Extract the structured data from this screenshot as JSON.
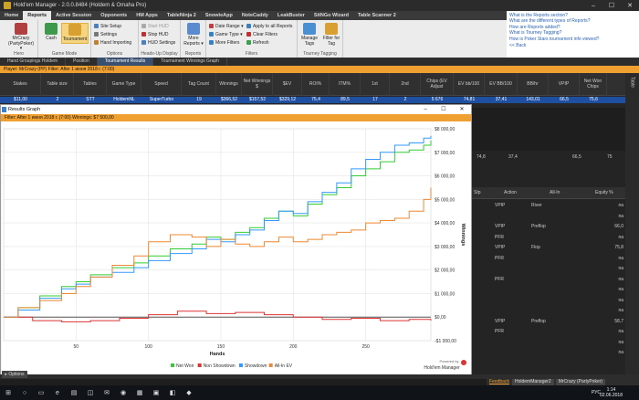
{
  "window": {
    "title": "Hold'em Manager - 2.0.0.8484 (Holdem & Omaha Pro)"
  },
  "menu": [
    "Home",
    "Reports",
    "Active Session",
    "Opponents",
    "HM Apps",
    "TableNinja 2",
    "SnowieApp",
    "NoteCaddy",
    "LeakBuster",
    "SitNGo Wizard",
    "Table Scanner 2"
  ],
  "menu_active": "Reports",
  "ribbon": {
    "hero": {
      "btn": "MrCrazy (PartyPoker) ▾",
      "cap": "Hero"
    },
    "game_mode": {
      "cash": "Cash",
      "tournament": "Tournament",
      "cap": "Game Mode"
    },
    "options": {
      "site_setup": "Site Setup",
      "settings": "Settings",
      "hand_importing": "Hand Importing",
      "cap": "Options"
    },
    "hud": {
      "start": "Start HUD",
      "stop": "Stop HUD",
      "settings": "HUD Settings",
      "cap": "Heads-Up Display"
    },
    "reports": {
      "more": "More Reports ▾",
      "cap": "Reports"
    },
    "filters": {
      "date_range": "Date Range ▾",
      "game_type": "Game Type ▾",
      "more_filters": "More Filters",
      "apply_all": "Apply to all Reports",
      "clear": "Clear Filters",
      "refresh": "Refresh",
      "cap": "Filters"
    },
    "tags": {
      "manage": "Manage Tags",
      "filter_tag": "Filter for Tag",
      "cap": "Tourney Tagging"
    }
  },
  "help": {
    "links": [
      "What is the Reports section?",
      "What are the different types of Reports?",
      "How are Reports added?",
      "What is Tourney Tagging?",
      "How is Poker Stars tournament info viewed?"
    ],
    "back": "<< Back"
  },
  "report_tabs": [
    "Hand Groupings Holdem",
    "Position",
    "Tournament Results",
    "Tournament Winnings Graph"
  ],
  "report_tab_active": "Tournament Results",
  "player_bar": "Player: MrCrazy (PP)  Filter: After 1 июня 2018 г. (7:00)",
  "results_grid": {
    "headers": [
      "Stakes",
      "Table size",
      "Tables",
      "Game Type",
      "Speed",
      "Tag Count",
      "Winnings",
      "Net Winnings $",
      "$EV",
      "ROI%",
      "ITM%",
      "1st",
      "2nd",
      "Chips (EV Adjust",
      "EV bb/100",
      "EV BB/100",
      "BB/hr",
      "VPIP",
      "Net Won Chips"
    ],
    "row": [
      "$11,00",
      "2",
      "STT",
      "HoldemNL",
      "SuperTurbo",
      "19",
      "$366,52",
      "$157,52",
      "$329,12",
      "75,4",
      "89,5",
      "17",
      "2",
      "5 676",
      "74,81",
      "37,41",
      "143,01",
      "66,5",
      "75,6"
    ]
  },
  "side_tab": "Table",
  "lower_panel": {
    "summary": [
      "74,8",
      "37,4",
      "66,5",
      "75"
    ],
    "headers": [
      "Stp",
      "Action",
      "All-In",
      "Equity %"
    ],
    "rows": [
      {
        "a": "VPIP",
        "b": "River",
        "c": "na"
      },
      {
        "a": "",
        "b": "",
        "c": "na"
      },
      {
        "a": "VPIP",
        "b": "Preflop",
        "c": "66,0"
      },
      {
        "a": "PFR",
        "b": "",
        "c": "na"
      },
      {
        "a": "VPIP",
        "b": "Flop",
        "c": "75,8"
      },
      {
        "a": "PFR",
        "b": "",
        "c": "na"
      },
      {
        "a": "",
        "b": "",
        "c": "na"
      },
      {
        "a": "PFR",
        "b": "",
        "c": "na"
      },
      {
        "a": "",
        "b": "",
        "c": "na"
      },
      {
        "a": "",
        "b": "",
        "c": "na"
      },
      {
        "a": "",
        "b": "",
        "c": "na"
      },
      {
        "a": "VPIP",
        "b": "Preflop",
        "c": "58,7"
      },
      {
        "a": "PFR",
        "b": "",
        "c": "na"
      },
      {
        "a": "",
        "b": "",
        "c": "na"
      },
      {
        "a": "",
        "b": "",
        "c": "na"
      }
    ]
  },
  "graph_window": {
    "title": "Results Graph",
    "filter": "Filter: After 1 июня 2018 г. (7:00)  Winnings: $7 500,00",
    "powered_line1": "Powered by",
    "powered_line2": "Hold'em Manager"
  },
  "chart_data": {
    "type": "line",
    "xlabel": "Hands",
    "ylabel": "Winnings",
    "xlim": [
      0,
      295
    ],
    "ylim": [
      -1000,
      8000
    ],
    "x_ticks": [
      50,
      100,
      150,
      200,
      250
    ],
    "y_ticks": [
      -1000,
      0,
      1000,
      2000,
      3000,
      4000,
      5000,
      6000,
      7000,
      8000
    ],
    "y_tick_labels": [
      "-$1 000,00",
      "$0,00",
      "$1 000,00",
      "$2 000,00",
      "$3 000,00",
      "$4 000,00",
      "$5 000,00",
      "$6 000,00",
      "$7 000,00",
      "$8 000,00"
    ],
    "grid": true,
    "legend_position": "bottom",
    "series": [
      {
        "name": "Net Won",
        "color": "#33cc33",
        "x": [
          0,
          10,
          25,
          40,
          50,
          60,
          75,
          90,
          100,
          115,
          130,
          140,
          150,
          160,
          170,
          180,
          190,
          200,
          210,
          220,
          230,
          240,
          250,
          260,
          270,
          280,
          290,
          295
        ],
        "values": [
          0,
          400,
          900,
          1300,
          1500,
          1800,
          2100,
          2300,
          2600,
          2900,
          3100,
          3400,
          3300,
          3600,
          3800,
          4200,
          4500,
          4300,
          4800,
          5200,
          5500,
          6000,
          6300,
          6600,
          7000,
          7100,
          7300,
          7500
        ]
      },
      {
        "name": "Non Showdown",
        "color": "#dd3333",
        "x": [
          0,
          20,
          40,
          60,
          80,
          100,
          120,
          140,
          160,
          180,
          200,
          220,
          240,
          260,
          280,
          295
        ],
        "values": [
          0,
          -150,
          -200,
          -150,
          -50,
          100,
          250,
          150,
          200,
          100,
          0,
          -100,
          -50,
          -150,
          -100,
          -150
        ]
      },
      {
        "name": "Showdown",
        "color": "#3399ff",
        "x": [
          0,
          10,
          25,
          40,
          50,
          60,
          75,
          90,
          100,
          115,
          130,
          140,
          150,
          160,
          170,
          180,
          190,
          200,
          210,
          220,
          230,
          240,
          250,
          260,
          270,
          280,
          290,
          295
        ],
        "values": [
          0,
          300,
          800,
          1200,
          1400,
          1700,
          1900,
          2100,
          2400,
          2700,
          2900,
          3300,
          3200,
          3500,
          3700,
          4100,
          4500,
          4400,
          4900,
          5300,
          5700,
          6300,
          6700,
          7000,
          7300,
          7400,
          7600,
          7700
        ]
      },
      {
        "name": "All-In EV",
        "color": "#ee8833",
        "x": [
          0,
          10,
          25,
          40,
          50,
          60,
          75,
          90,
          100,
          115,
          130,
          140,
          150,
          160,
          170,
          180,
          190,
          200,
          210,
          220,
          230,
          240,
          250,
          260,
          270,
          280,
          290,
          295
        ],
        "values": [
          0,
          400,
          700,
          1000,
          1300,
          1700,
          2200,
          2600,
          3200,
          3500,
          3400,
          3000,
          3300,
          3100,
          3000,
          3200,
          3400,
          3200,
          3300,
          3500,
          3600,
          3700,
          4000,
          4100,
          4200,
          4500,
          5000,
          5500
        ]
      }
    ]
  },
  "options_btn": "▸ Options",
  "tray": {
    "feedback": "Feedback",
    "tab1": "HoldemManager2",
    "tab2": "MrCrazy (PartyPoker)"
  },
  "taskbar": {
    "lang": "РУС",
    "time": "1:14",
    "date": "02.06.2018"
  }
}
